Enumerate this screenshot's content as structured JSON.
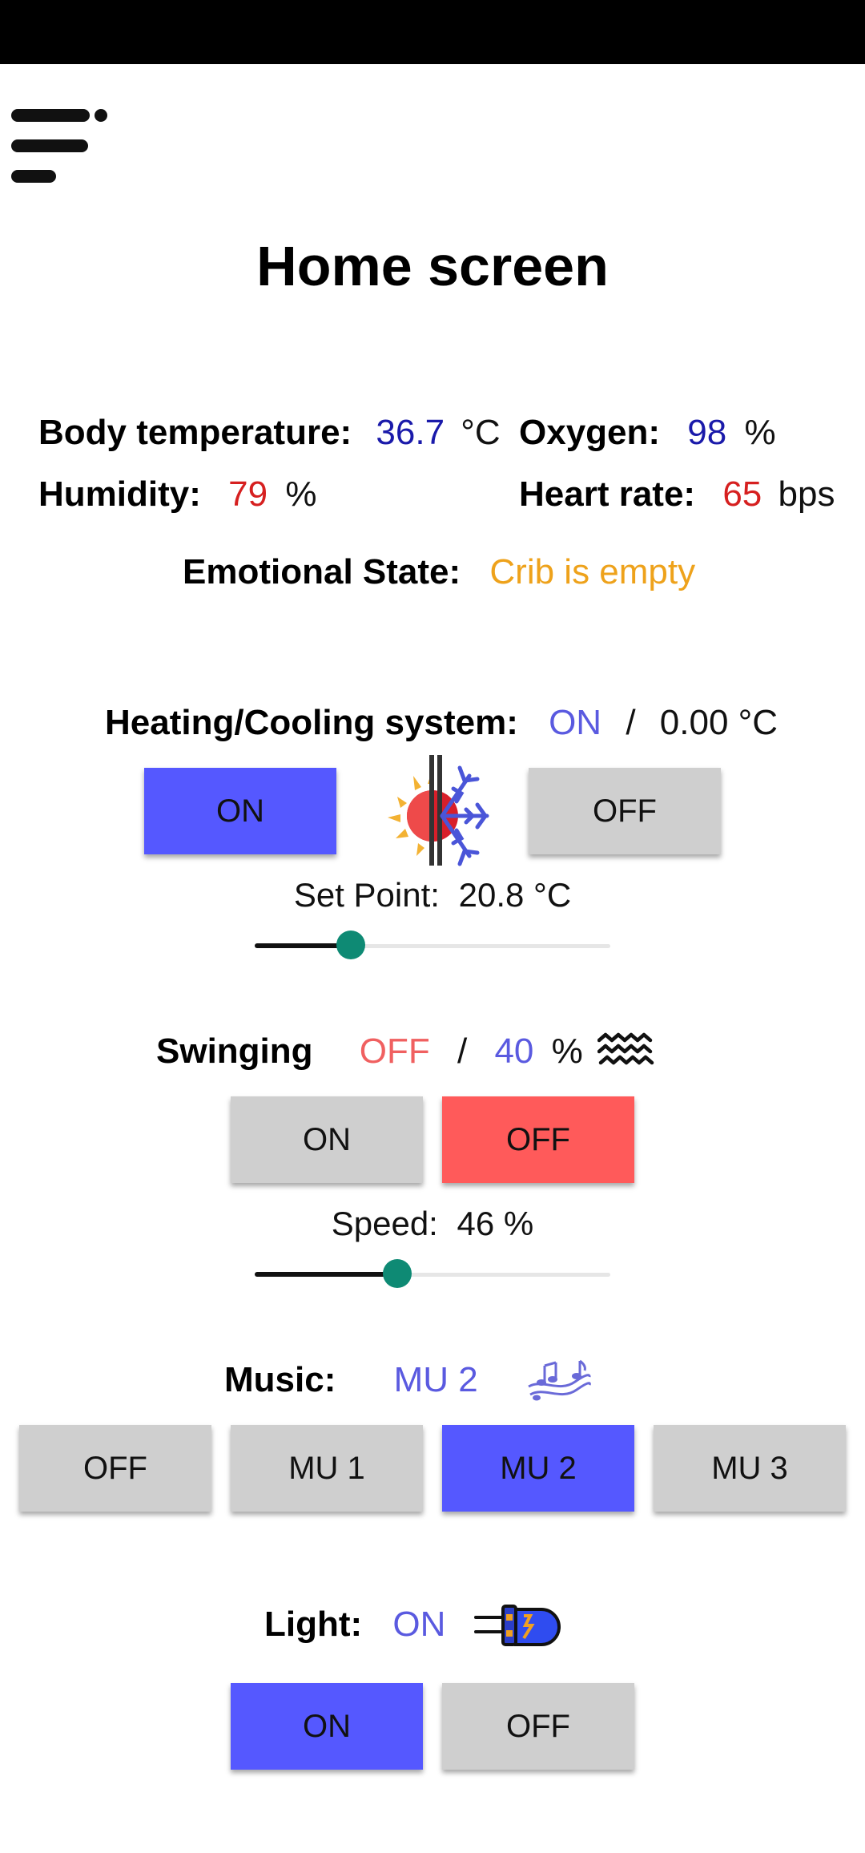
{
  "header": {
    "title": "Home screen",
    "menu_icon": "menu-icon"
  },
  "vitals": {
    "body_temperature": {
      "label": "Body temperature:",
      "value": "36.7",
      "unit": "°C"
    },
    "oxygen": {
      "label": "Oxygen:",
      "value": "98",
      "unit": "%"
    },
    "humidity": {
      "label": "Humidity:",
      "value": "79",
      "unit": "%"
    },
    "heart_rate": {
      "label": "Heart rate:",
      "value": "65",
      "unit": "bps"
    },
    "emotional_state": {
      "label": "Emotional State:",
      "value": "Crib is empty"
    }
  },
  "heating": {
    "label": "Heating/Cooling system:",
    "status": "ON",
    "separator": "/",
    "temperature": "0.00 °C",
    "on_label": "ON",
    "off_label": "OFF",
    "icon": "sun-snowflake-icon",
    "setpoint_label": "Set Point:",
    "setpoint_value": "20.8 °C",
    "slider_fraction": 0.27
  },
  "swinging": {
    "label": "Swinging",
    "status": "OFF",
    "separator": "/",
    "percent_value": "40",
    "percent_unit": "%",
    "icon": "waves-icon",
    "on_label": "ON",
    "off_label": "OFF",
    "speed_label": "Speed:",
    "speed_value": "46 %",
    "slider_fraction": 0.4
  },
  "music": {
    "label": "Music:",
    "current": "MU 2",
    "icon": "music-notes-icon",
    "buttons": [
      "OFF",
      "MU 1",
      "MU 2",
      "MU 3"
    ],
    "active_index": 2
  },
  "light": {
    "label": "Light:",
    "status": "ON",
    "icon": "led-bulb-icon",
    "on_label": "ON",
    "off_label": "OFF"
  },
  "colors": {
    "accent_blue": "#5558ff",
    "active_red": "#ff5a5a",
    "inactive_gray": "#cfcfcf",
    "slider_thumb": "#0e8a74"
  }
}
